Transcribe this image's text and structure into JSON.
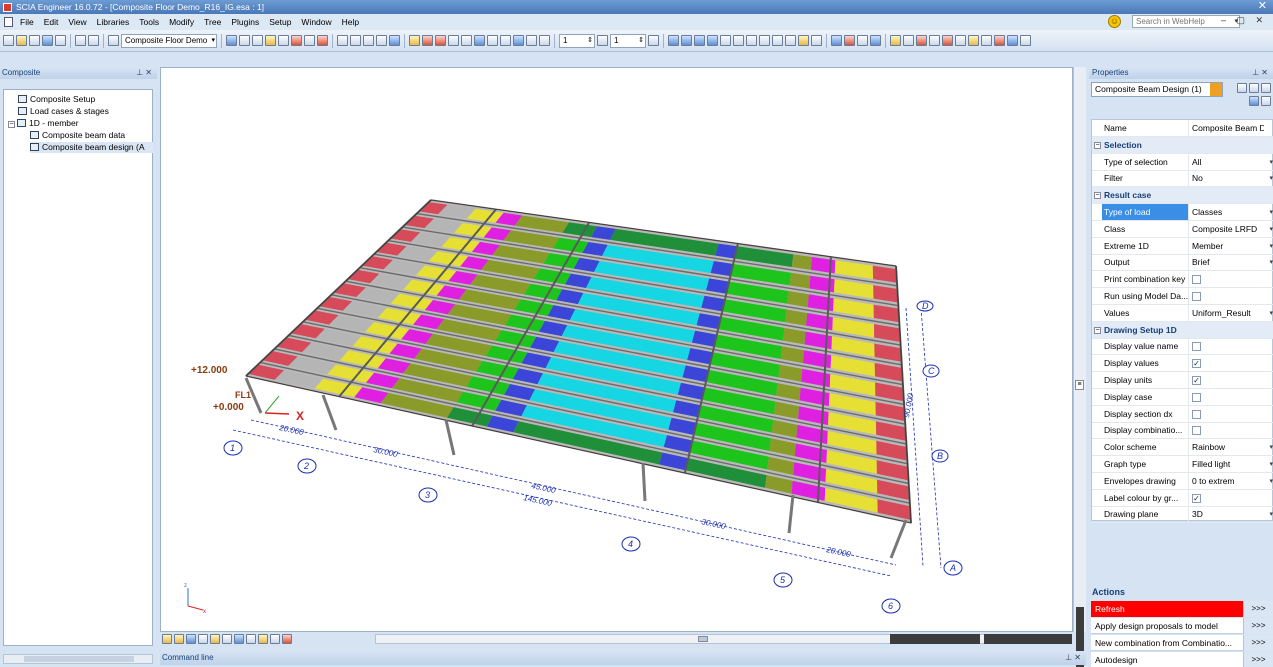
{
  "window": {
    "title": "SCIA Engineer 16.0.72 - [Composite Floor Demo_R16_IG.esa : 1]",
    "close_glyph": "✕",
    "controls": "– ▢ ✕"
  },
  "menu": [
    "File",
    "Edit",
    "View",
    "Libraries",
    "Tools",
    "Modify",
    "Tree",
    "Plugins",
    "Setup",
    "Window",
    "Help"
  ],
  "help_search": {
    "placeholder": "Search in WebHelp"
  },
  "toolbar": {
    "project_combo": "Composite Floor Demo",
    "spin1": "1",
    "spin2": "1"
  },
  "left_panel": {
    "title": "Composite",
    "tree": [
      {
        "label": "Composite Setup"
      },
      {
        "label": "Load cases & stages"
      },
      {
        "label": "1D - member"
      },
      {
        "label": "Composite beam data"
      },
      {
        "label": "Composite beam design (A"
      }
    ]
  },
  "viewport": {
    "labels": {
      "level_top": "+12.000",
      "level_bottom": "+0.000",
      "floor_label": "FL1"
    },
    "grid_x": [
      "1",
      "2",
      "3",
      "4",
      "5",
      "6"
    ],
    "grid_y": [
      "A",
      "B",
      "C",
      "D"
    ],
    "dimensions": [
      "20.000",
      "30.000",
      "45.000",
      "145.000",
      "30.000",
      "20.000",
      "90.000"
    ],
    "axis_labels": {
      "x": "x",
      "z": "z"
    }
  },
  "properties": {
    "title": "Properties",
    "selector": "Composite Beam Design (1)",
    "rows": [
      {
        "type": "row",
        "key": "Name",
        "value": "Composite Beam D..."
      },
      {
        "type": "section",
        "key": "Selection"
      },
      {
        "type": "row",
        "key": "Type of selection",
        "value": "All",
        "dropdown": true
      },
      {
        "type": "row",
        "key": "Filter",
        "value": "No",
        "dropdown": true
      },
      {
        "type": "section",
        "key": "Result case"
      },
      {
        "type": "row",
        "key": "Type of load",
        "value": "Classes",
        "dropdown": true,
        "selected": true
      },
      {
        "type": "row",
        "key": "Class",
        "value": "Composite LRFD",
        "dropdown": true
      },
      {
        "type": "row",
        "key": "Extreme 1D",
        "value": "Member",
        "dropdown": true
      },
      {
        "type": "row",
        "key": "Output",
        "value": "Brief",
        "dropdown": true
      },
      {
        "type": "check",
        "key": "Print combination key",
        "checked": false
      },
      {
        "type": "check",
        "key": "Run using Model Da...",
        "checked": false
      },
      {
        "type": "row",
        "key": "Values",
        "value": "Uniform_Result",
        "dropdown": true
      },
      {
        "type": "section",
        "key": "Drawing Setup 1D"
      },
      {
        "type": "check",
        "key": "Display value name",
        "checked": false
      },
      {
        "type": "check",
        "key": "Display values",
        "checked": true
      },
      {
        "type": "check",
        "key": "Display units",
        "checked": true
      },
      {
        "type": "check",
        "key": "Display case",
        "checked": false
      },
      {
        "type": "check",
        "key": "Display section dx",
        "checked": false
      },
      {
        "type": "check",
        "key": "Display combinatio...",
        "checked": false
      },
      {
        "type": "row",
        "key": "Color scheme",
        "value": "Rainbow",
        "dropdown": true
      },
      {
        "type": "row",
        "key": "Graph type",
        "value": "Filled light",
        "dropdown": true
      },
      {
        "type": "row",
        "key": "Envelopes drawing",
        "value": "0 to extrem",
        "dropdown": true
      },
      {
        "type": "check",
        "key": "Label colour by gr...",
        "checked": true
      },
      {
        "type": "row",
        "key": "Drawing plane",
        "value": "3D",
        "dropdown": true
      }
    ]
  },
  "actions": {
    "title": "Actions",
    "go_label": ">>>",
    "items": [
      {
        "label": "Refresh",
        "highlight": true
      },
      {
        "label": "Apply design proposals to model"
      },
      {
        "label": "New combination from Combinatio..."
      },
      {
        "label": "Autodesign"
      }
    ]
  },
  "command_line": {
    "title": "Command line"
  },
  "colors": {
    "cyan": "#16d6e3",
    "blue": "#3b45d8",
    "green": "#1cc41c",
    "yellow": "#e6e034",
    "magenta": "#e020e0",
    "red": "#d64a5a",
    "olive": "#8b9b2a",
    "dimension": "#1a2eb0"
  }
}
